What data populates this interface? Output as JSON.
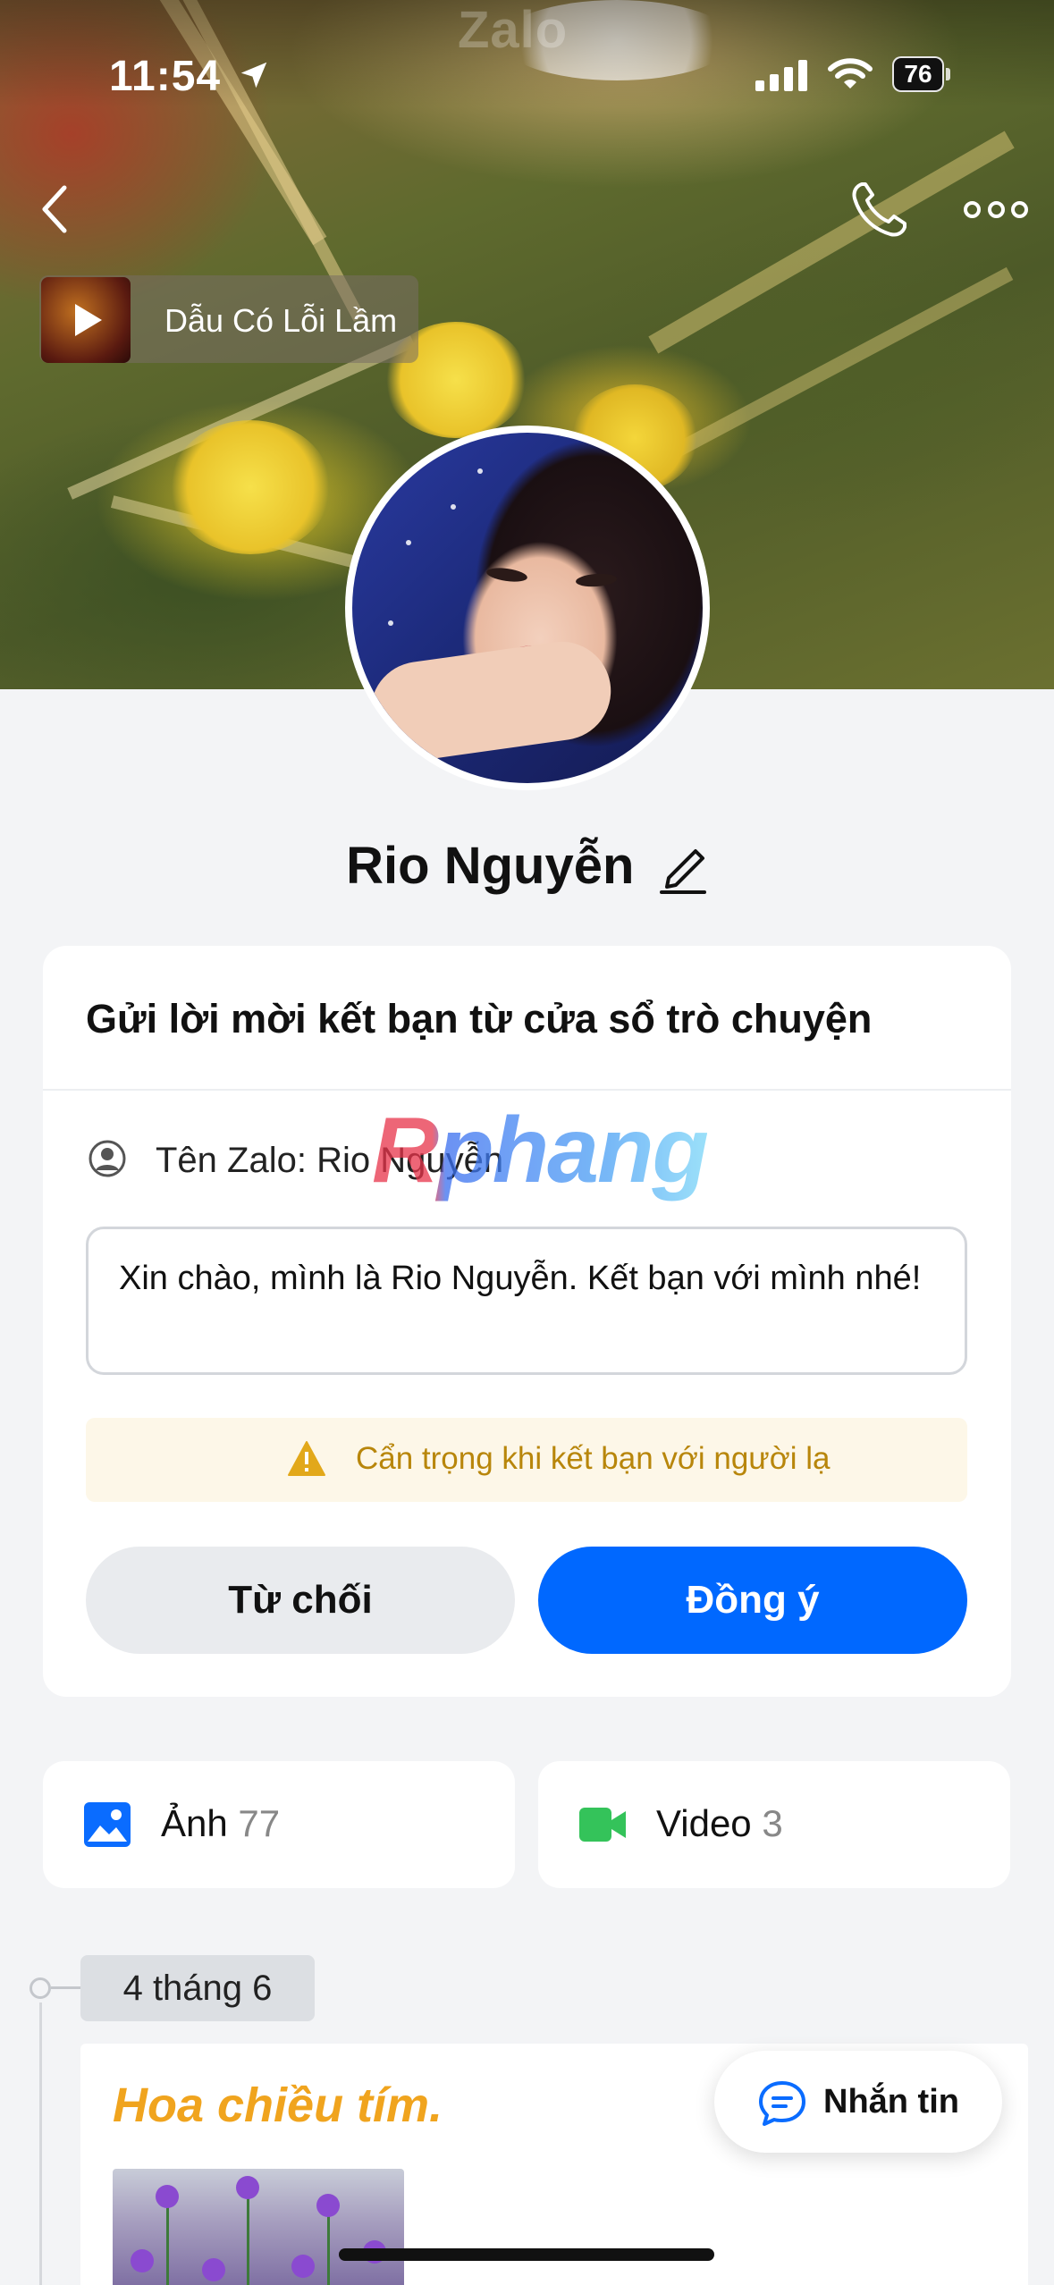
{
  "status_bar": {
    "time": "11:54",
    "battery": "76"
  },
  "cover": {
    "watermark": "Zalo"
  },
  "music": {
    "title": "Dẫu Có Lỗi Lầm"
  },
  "profile": {
    "name": "Rio Nguyễn"
  },
  "friend_request": {
    "heading": "Gửi lời mời kết bạn từ cửa sổ trò chuyện",
    "zalo_name": "Tên Zalo: Rio Nguyễn",
    "message": "Xin chào, mình là Rio Nguyễn. Kết bạn với mình nhé!",
    "warning": "Cẩn trọng khi kết bạn với người lạ",
    "decline_label": "Từ chối",
    "accept_label": "Đồng ý"
  },
  "overlay_watermark": "Rphang",
  "media": {
    "photos_label": "Ảnh",
    "photos_count": "77",
    "videos_label": "Video",
    "videos_count": "3"
  },
  "timeline": {
    "date": "4 tháng 6",
    "post_title": "Hoa chiều tím."
  },
  "chat_button": {
    "label": "Nhắn tin"
  },
  "colors": {
    "accent": "#0068ff",
    "warning_text": "#b8860b",
    "post_title": "#f0a41e",
    "video_icon": "#34c35a"
  }
}
